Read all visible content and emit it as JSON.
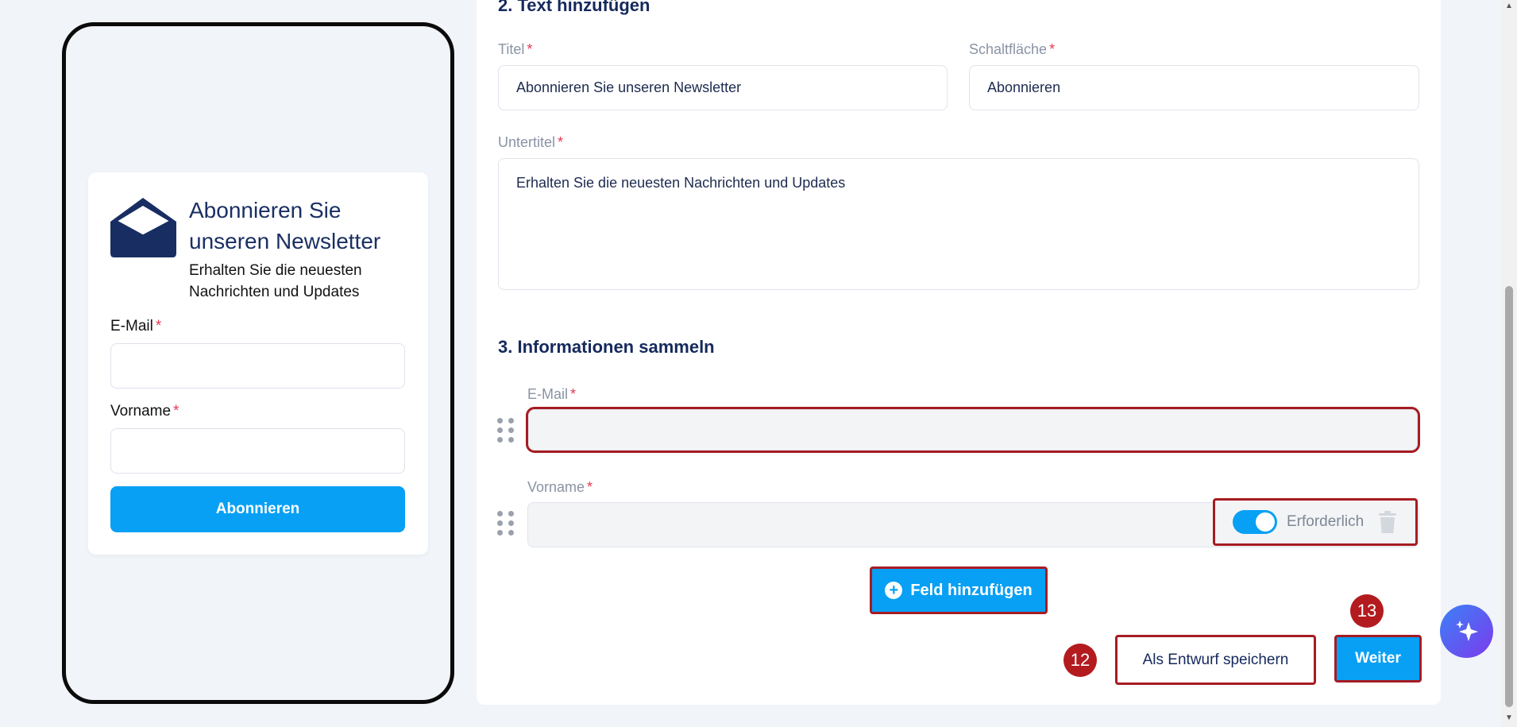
{
  "preview": {
    "title": "Abonnieren Sie unseren Newsletter",
    "subtitle": "Erhalten Sie die neuesten Nachrichten und Updates",
    "fields": [
      {
        "label": "E-Mail",
        "required_mark": "*"
      },
      {
        "label": "Vorname",
        "required_mark": "*"
      }
    ],
    "button_label": "Abonnieren"
  },
  "form": {
    "section2_title": "2. Text hinzufügen",
    "title_label": "Titel",
    "title_value": "Abonnieren Sie unseren Newsletter",
    "button_label": "Schaltfläche",
    "button_value": "Abonnieren",
    "subtitle_label": "Untertitel",
    "subtitle_value": "Erhalten Sie die neuesten Nachrichten und Updates",
    "required_mark": "*",
    "section3_title": "3. Informationen sammeln",
    "fields": [
      {
        "label": "E-Mail",
        "value": ""
      },
      {
        "label": "Vorname",
        "value": "",
        "required_toggle_label": "Erforderlich",
        "required": true
      }
    ],
    "add_field_label": "Feld hinzufügen",
    "save_draft_label": "Als Entwurf speichern",
    "next_label": "Weiter"
  },
  "step_badges": {
    "draft": "12",
    "next": "13"
  },
  "colors": {
    "accent": "#07a0f5",
    "highlight": "#a61c22",
    "navy": "#15295c"
  },
  "icons": [
    "envelope-open-icon",
    "drag-handle-icon",
    "trash-icon",
    "plus-circle-icon",
    "sparkles-icon"
  ]
}
